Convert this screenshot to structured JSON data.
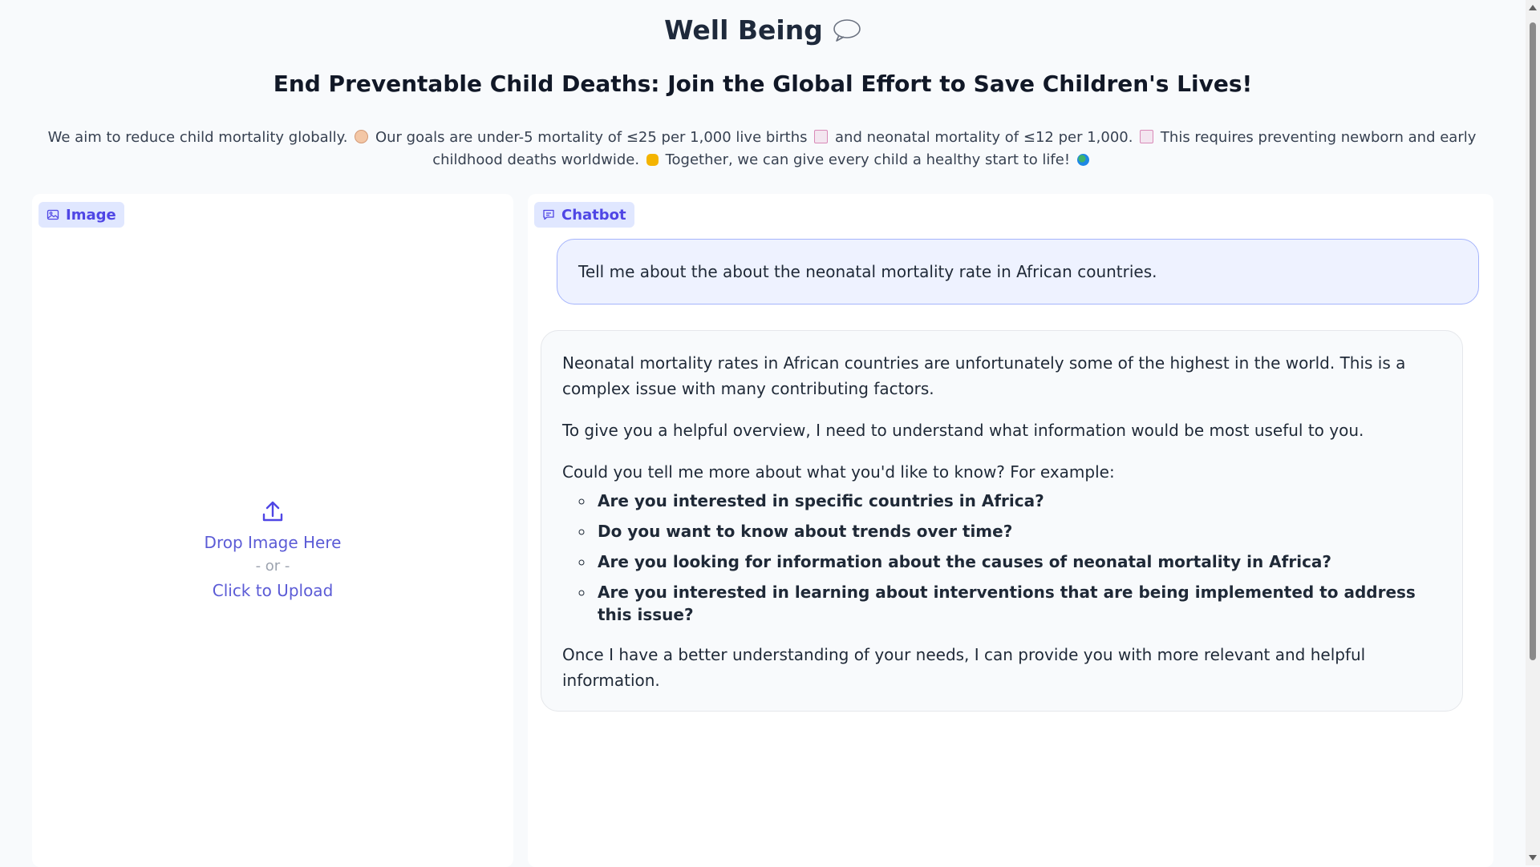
{
  "header": {
    "title": "Well Being",
    "subtitle": "End Preventable Child Deaths: Join the Global Effort to Save Children's Lives!",
    "description": {
      "part1": "We aim to reduce child mortality globally.",
      "part2": "Our goals are under-5 mortality of ≤25 per 1,000 live births",
      "part3": "and neonatal mortality of ≤12 per 1,000.",
      "part4": "This requires preventing newborn and early childhood deaths worldwide.",
      "part5": "Together, we can give every child a healthy start to life!"
    }
  },
  "image_panel": {
    "label": "Image",
    "drop_text": "Drop Image Here",
    "or_text": "- or -",
    "click_text": "Click to Upload"
  },
  "chatbot": {
    "label": "Chatbot",
    "user_message": "Tell me about the about the neonatal mortality rate in African countries.",
    "bot_message": {
      "p1": "Neonatal mortality rates in African countries are unfortunately some of the highest in the world. This is a complex issue with many contributing factors.",
      "p2": "To give you a helpful overview, I need to understand what information would be most useful to you.",
      "p3": "Could you tell me more about what you'd like to know? For example:",
      "items": [
        "Are you interested in specific countries in Africa?",
        "Do you want to know about trends over time?",
        "Are you looking for information about the causes of neonatal mortality in Africa?",
        "Are you interested in learning about interventions that are being implemented to address this issue?"
      ],
      "p4": "Once I have a better understanding of your needs, I can provide you with more relevant and helpful information."
    }
  },
  "colors": {
    "accent": "#4f46e5",
    "chip_bg": "#e0e7ff",
    "user_bubble": "#eef2ff",
    "bot_bubble": "#f8fafc"
  }
}
